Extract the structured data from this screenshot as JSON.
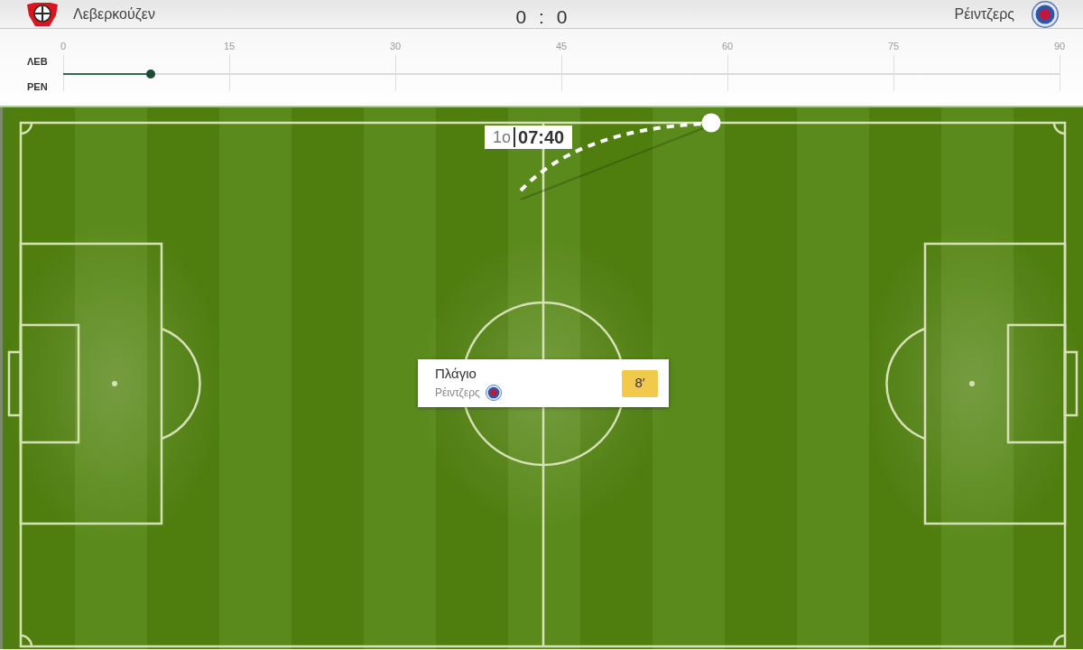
{
  "header": {
    "home_team": {
      "name": "Λεβερκούζεν"
    },
    "score": "0 : 0",
    "away_team": {
      "name": "Ρέιντζερς"
    }
  },
  "timeline": {
    "ticks": [
      "0",
      "15",
      "30",
      "45",
      "60",
      "75",
      "90"
    ],
    "rows": [
      {
        "label": "ΛΕΒ"
      },
      {
        "label": "ΡΕΝ"
      }
    ],
    "progress": {
      "level": 0.088
    }
  },
  "pitch": {
    "clock": {
      "period": "1ο",
      "time": "07:40"
    },
    "event": {
      "title": "Πλάγιο",
      "team": "Ρέιντζερς",
      "minute": "8′"
    }
  }
}
